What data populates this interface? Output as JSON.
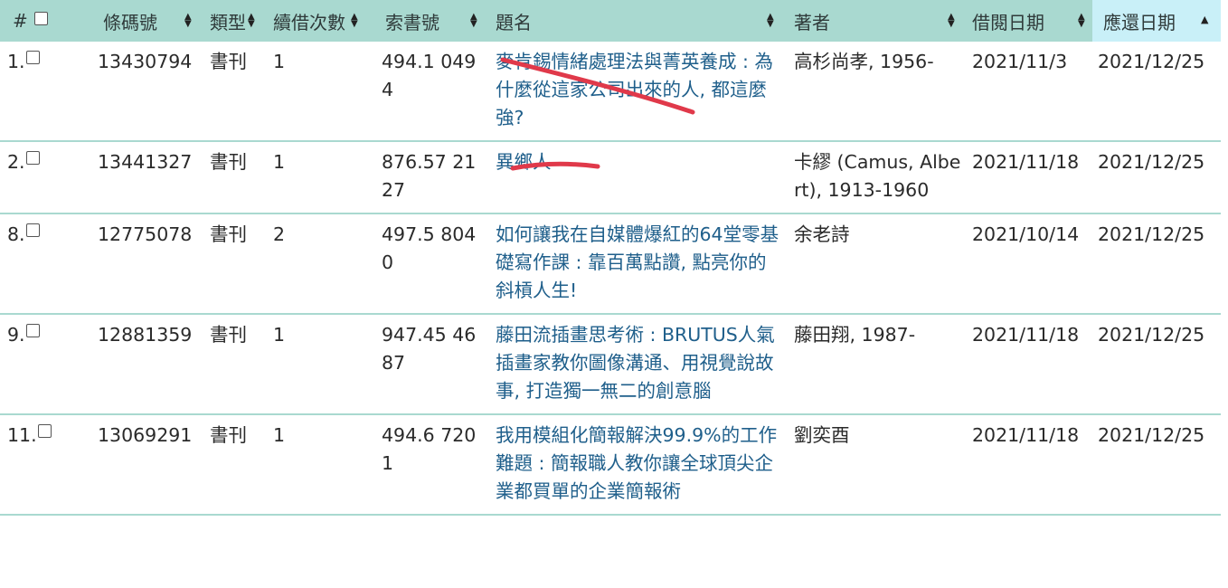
{
  "header": {
    "index": "#",
    "barcode": "條碼號",
    "type": "類型",
    "renewals": "續借次數",
    "callno": "索書號",
    "title": "題名",
    "author": "著者",
    "borrow_date": "借閱日期",
    "due_date": "應還日期"
  },
  "rows": [
    {
      "index": "1.",
      "barcode": "13430794",
      "type": "書刊",
      "renewals": "1",
      "callno": "494.1 0494",
      "title": "麥肯錫情緒處理法與菁英養成 : 為什麼從這家公司出來的人, 都這麼強?",
      "author": "高杉尚孝, 1956-",
      "borrow_date": "2021/11/3",
      "due_date": "2021/12/25"
    },
    {
      "index": "2.",
      "barcode": "13441327",
      "type": "書刊",
      "renewals": "1",
      "callno": "876.57 2127",
      "title": "異鄉人",
      "author": "卡繆 (Camus, Albert), 1913-1960",
      "borrow_date": "2021/11/18",
      "due_date": "2021/12/25"
    },
    {
      "index": "8.",
      "barcode": "12775078",
      "type": "書刊",
      "renewals": "2",
      "callno": "497.5 8040",
      "title": "如何讓我在自媒體爆紅的64堂零基礎寫作課 : 靠百萬點讚, 點亮你的斜槓人生!",
      "author": "余老詩",
      "borrow_date": "2021/10/14",
      "due_date": "2021/12/25"
    },
    {
      "index": "9.",
      "barcode": "12881359",
      "type": "書刊",
      "renewals": "1",
      "callno": "947.45 4687",
      "title": "藤田流插畫思考術 : BRUTUS人氣插畫家教你圖像溝通、用視覺說故事, 打造獨一無二的創意腦",
      "author": "藤田翔, 1987-",
      "borrow_date": "2021/11/18",
      "due_date": "2021/12/25"
    },
    {
      "index": "11.",
      "barcode": "13069291",
      "type": "書刊",
      "renewals": "1",
      "callno": "494.6 7201",
      "title": "我用模組化簡報解決99.9%的工作難題 : 簡報職人教你讓全球頂尖企業都買單的企業簡報術",
      "author": "劉奕酉",
      "borrow_date": "2021/11/18",
      "due_date": "2021/12/25"
    }
  ],
  "colors": {
    "header_bg": "#a9d9d0",
    "active_header_bg": "#c9f0f8",
    "link": "#1f5f8b",
    "annotation": "#e0394a"
  }
}
